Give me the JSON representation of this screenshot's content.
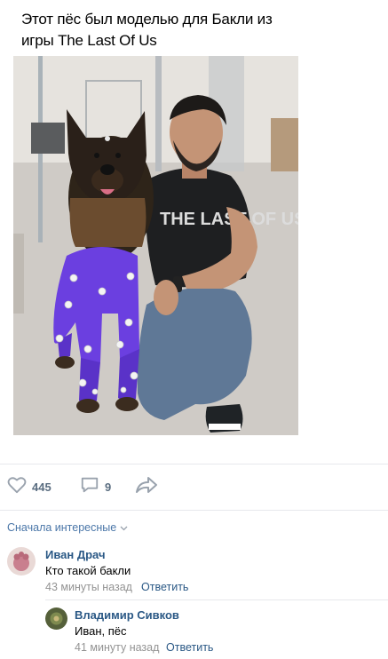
{
  "post": {
    "text": "Этот пёс был моделью для Бакли из игры The Last Of Us",
    "image_alt": "Собака в костюме для захвата движений рядом с мужчиной",
    "shirt_lettering": "THE LAST OF US"
  },
  "actions": {
    "likes": "445",
    "comments": "9"
  },
  "comments_sort": {
    "label": "Сначала интересные"
  },
  "comments": [
    {
      "author": "Иван Драч",
      "text": "Кто такой бакли",
      "time": "43 минуты назад",
      "reply_label": "Ответить"
    },
    {
      "author": "Владимир Сивков",
      "text": "Иван, пёс",
      "time": "41 минуту назад",
      "reply_label": "Ответить"
    }
  ],
  "colors": {
    "link": "#2a5885",
    "meta": "#939393",
    "icon": "#99a2ad",
    "divider": "#e7e8ec"
  },
  "icons": [
    "heart-icon",
    "comment-icon",
    "share-icon",
    "chevron-down-icon"
  ]
}
